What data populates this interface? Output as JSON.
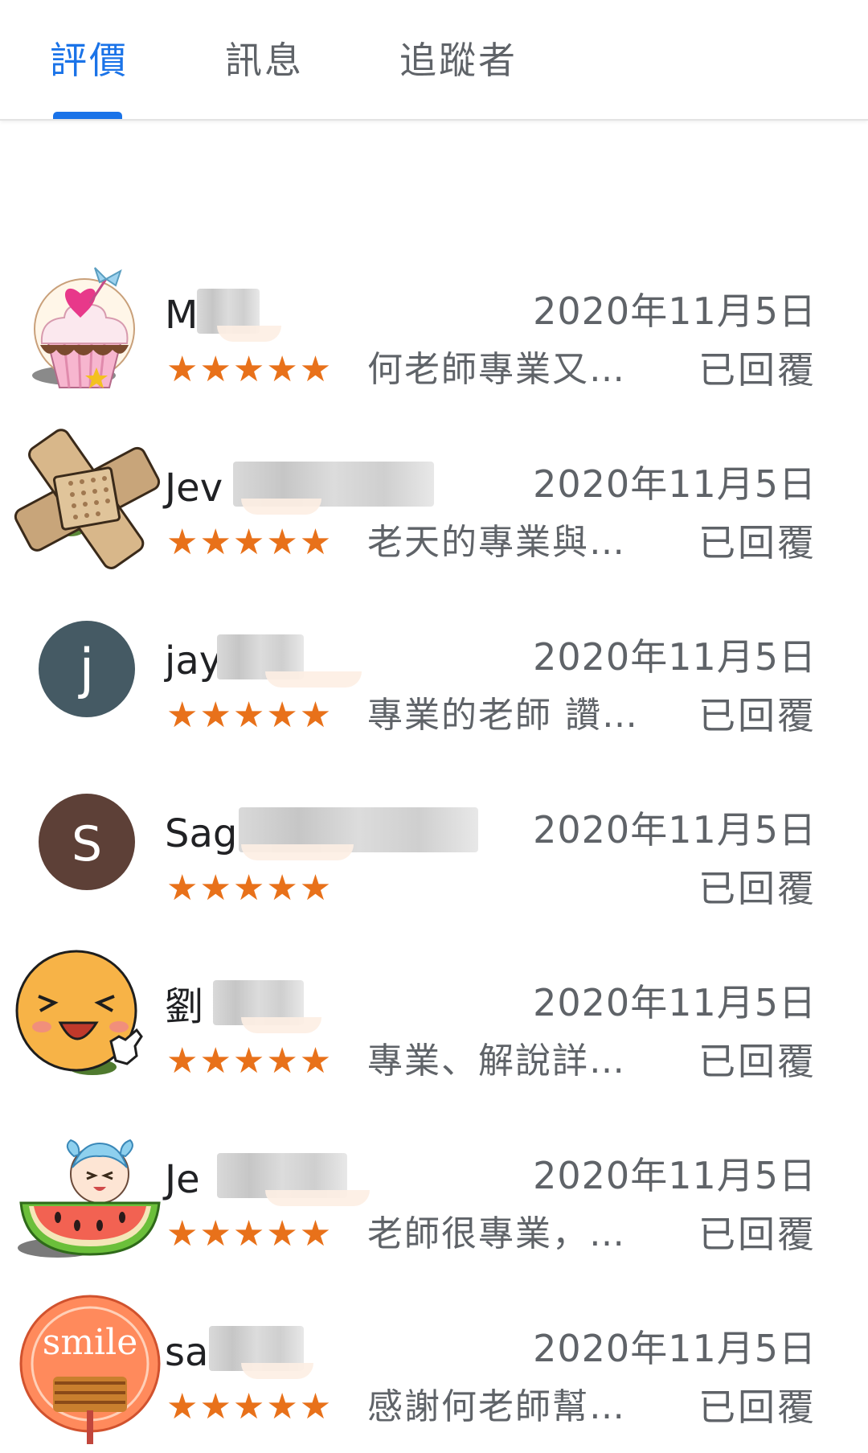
{
  "tabs": [
    {
      "label": "評價",
      "active": true
    },
    {
      "label": "訊息",
      "active": false
    },
    {
      "label": "追蹤者",
      "active": false
    }
  ],
  "colors": {
    "accent": "#1a73e8",
    "star": "#e8711a",
    "secondary_text": "#5f6368"
  },
  "reviews": [
    {
      "name": "M",
      "avatar": "cupcake-avatar",
      "date": "2020年11月5日",
      "stars": "★★★★★",
      "rating": 5,
      "snippet": "何老師專業又…",
      "status": "已回覆"
    },
    {
      "name": "Jev",
      "avatar": "bandage-avatar",
      "date": "2020年11月5日",
      "stars": "★★★★★",
      "rating": 5,
      "snippet": "老天的專業與…",
      "status": "已回覆"
    },
    {
      "name": "jay",
      "avatar": "letter-avatar",
      "avatar_letter": "j",
      "avatar_color": "#455a64",
      "date": "2020年11月5日",
      "stars": "★★★★★",
      "rating": 5,
      "snippet": "專業的老師 讚…",
      "status": "已回覆"
    },
    {
      "name": "Sag",
      "avatar": "letter-avatar",
      "avatar_letter": "S",
      "avatar_color": "#5d4037",
      "date": "2020年11月5日",
      "stars": "★★★★★",
      "rating": 5,
      "snippet": "",
      "status": "已回覆"
    },
    {
      "name": "劉",
      "avatar": "laughing-face-avatar",
      "date": "2020年11月5日",
      "stars": "★★★★★",
      "rating": 5,
      "snippet": "專業、解說詳…",
      "status": "已回覆"
    },
    {
      "name": "Je",
      "avatar": "watermelon-girl-avatar",
      "date": "2020年11月5日",
      "stars": "★★★★★",
      "rating": 5,
      "snippet": "老師很專業，…",
      "status": "已回覆"
    },
    {
      "name": "sa",
      "avatar": "smile-fan-avatar",
      "avatar_text": "smile",
      "date": "2020年11月5日",
      "stars": "★★★★★",
      "rating": 5,
      "snippet": "感謝何老師幫…",
      "status": "已回覆"
    }
  ]
}
